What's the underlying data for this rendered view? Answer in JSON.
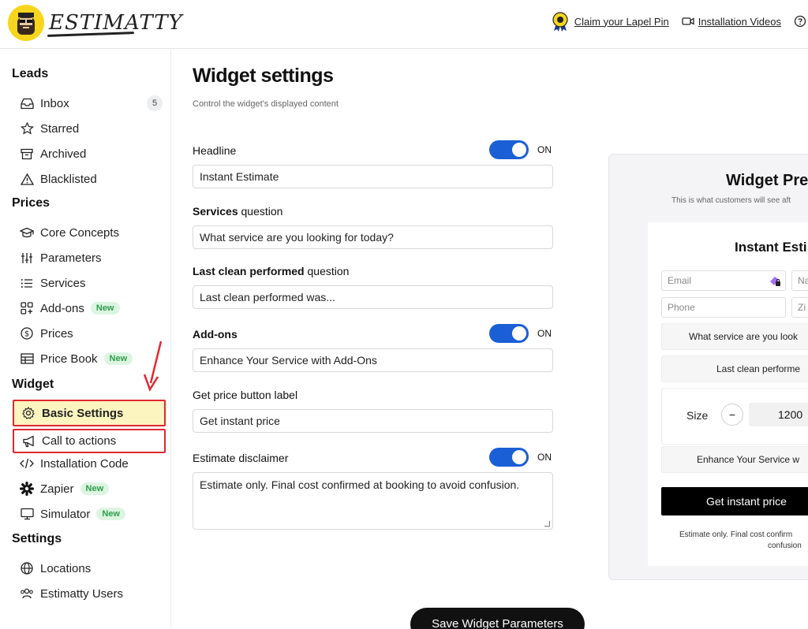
{
  "header": {
    "brand": "ESTIMATTY",
    "links": [
      {
        "label": "Claim your Lapel Pin",
        "icon": "medal-icon"
      },
      {
        "label": "Installation Videos",
        "icon": "video-camera-icon"
      }
    ],
    "help_icon": "help-circle-icon"
  },
  "sidebar": {
    "sections": {
      "leads": "Leads",
      "prices": "Prices",
      "widget": "Widget",
      "settings": "Settings"
    },
    "leads": [
      {
        "label": "Inbox",
        "icon": "inbox-icon",
        "count": "5"
      },
      {
        "label": "Starred",
        "icon": "star-icon"
      },
      {
        "label": "Archived",
        "icon": "archive-icon"
      },
      {
        "label": "Blacklisted",
        "icon": "warning-icon"
      }
    ],
    "prices": [
      {
        "label": "Core Concepts",
        "icon": "graduation-cap-icon"
      },
      {
        "label": "Parameters",
        "icon": "sliders-icon"
      },
      {
        "label": "Services",
        "icon": "list-icon"
      },
      {
        "label": "Add-ons",
        "icon": "add-ons-icon",
        "badge": "New"
      },
      {
        "label": "Prices",
        "icon": "dollar-icon"
      },
      {
        "label": "Price Book",
        "icon": "table-icon",
        "badge": "New"
      }
    ],
    "widget": [
      {
        "label": "Basic Settings",
        "icon": "gear-icon"
      },
      {
        "label": "Call to actions",
        "icon": "megaphone-icon"
      },
      {
        "label": "Installation Code",
        "icon": "code-icon"
      },
      {
        "label": "Zapier",
        "icon": "zapier-icon",
        "badge": "New"
      },
      {
        "label": "Simulator",
        "icon": "monitor-icon",
        "badge": "New"
      }
    ],
    "settings": [
      {
        "label": "Locations",
        "icon": "globe-icon"
      },
      {
        "label": "Estimatty Users",
        "icon": "users-icon"
      }
    ]
  },
  "main": {
    "title": "Widget settings",
    "subtitle": "Control the widget's displayed content",
    "headline": {
      "label": "Headline",
      "value": "Instant Estimate",
      "toggle": "ON"
    },
    "services_q": {
      "bold": "Services",
      "rest": " question",
      "value": "What service are you looking for today?"
    },
    "last_clean_q": {
      "bold": "Last clean performed",
      "rest": " question",
      "value": "Last clean performed was..."
    },
    "addons": {
      "label": "Add-ons",
      "value": "Enhance Your Service with Add-Ons",
      "toggle": "ON"
    },
    "price_btn": {
      "label": "Get price button label",
      "value": "Get instant price"
    },
    "disclaimer": {
      "label": "Estimate disclaimer",
      "value": "Estimate only. Final cost confirmed at booking to avoid confusion.",
      "toggle": "ON"
    },
    "save_label": "Save Widget Parameters"
  },
  "preview": {
    "title": "Widget Pre",
    "subtitle": "This is what customers will see aft",
    "heading": "Instant Esti",
    "email_ph": "Email",
    "name_ph": "Na",
    "phone_ph": "Phone",
    "zip_ph": "Zi",
    "service_select": "What service are you look",
    "last_clean_select": "Last clean performe",
    "size_label": "Size",
    "minus": "−",
    "size_value": "1200",
    "addons_select": "Enhance Your Service w",
    "button": "Get instant price",
    "disclaimer_line1": "Estimate only. Final cost confirm",
    "disclaimer_line2": "confusion"
  },
  "colors": {
    "accent": "#1a5fd6",
    "highlight": "#fdf5bf",
    "annotation_red": "#e0282f",
    "new_badge": "#2e9c4a",
    "logo_yellow": "#f7d51d"
  }
}
